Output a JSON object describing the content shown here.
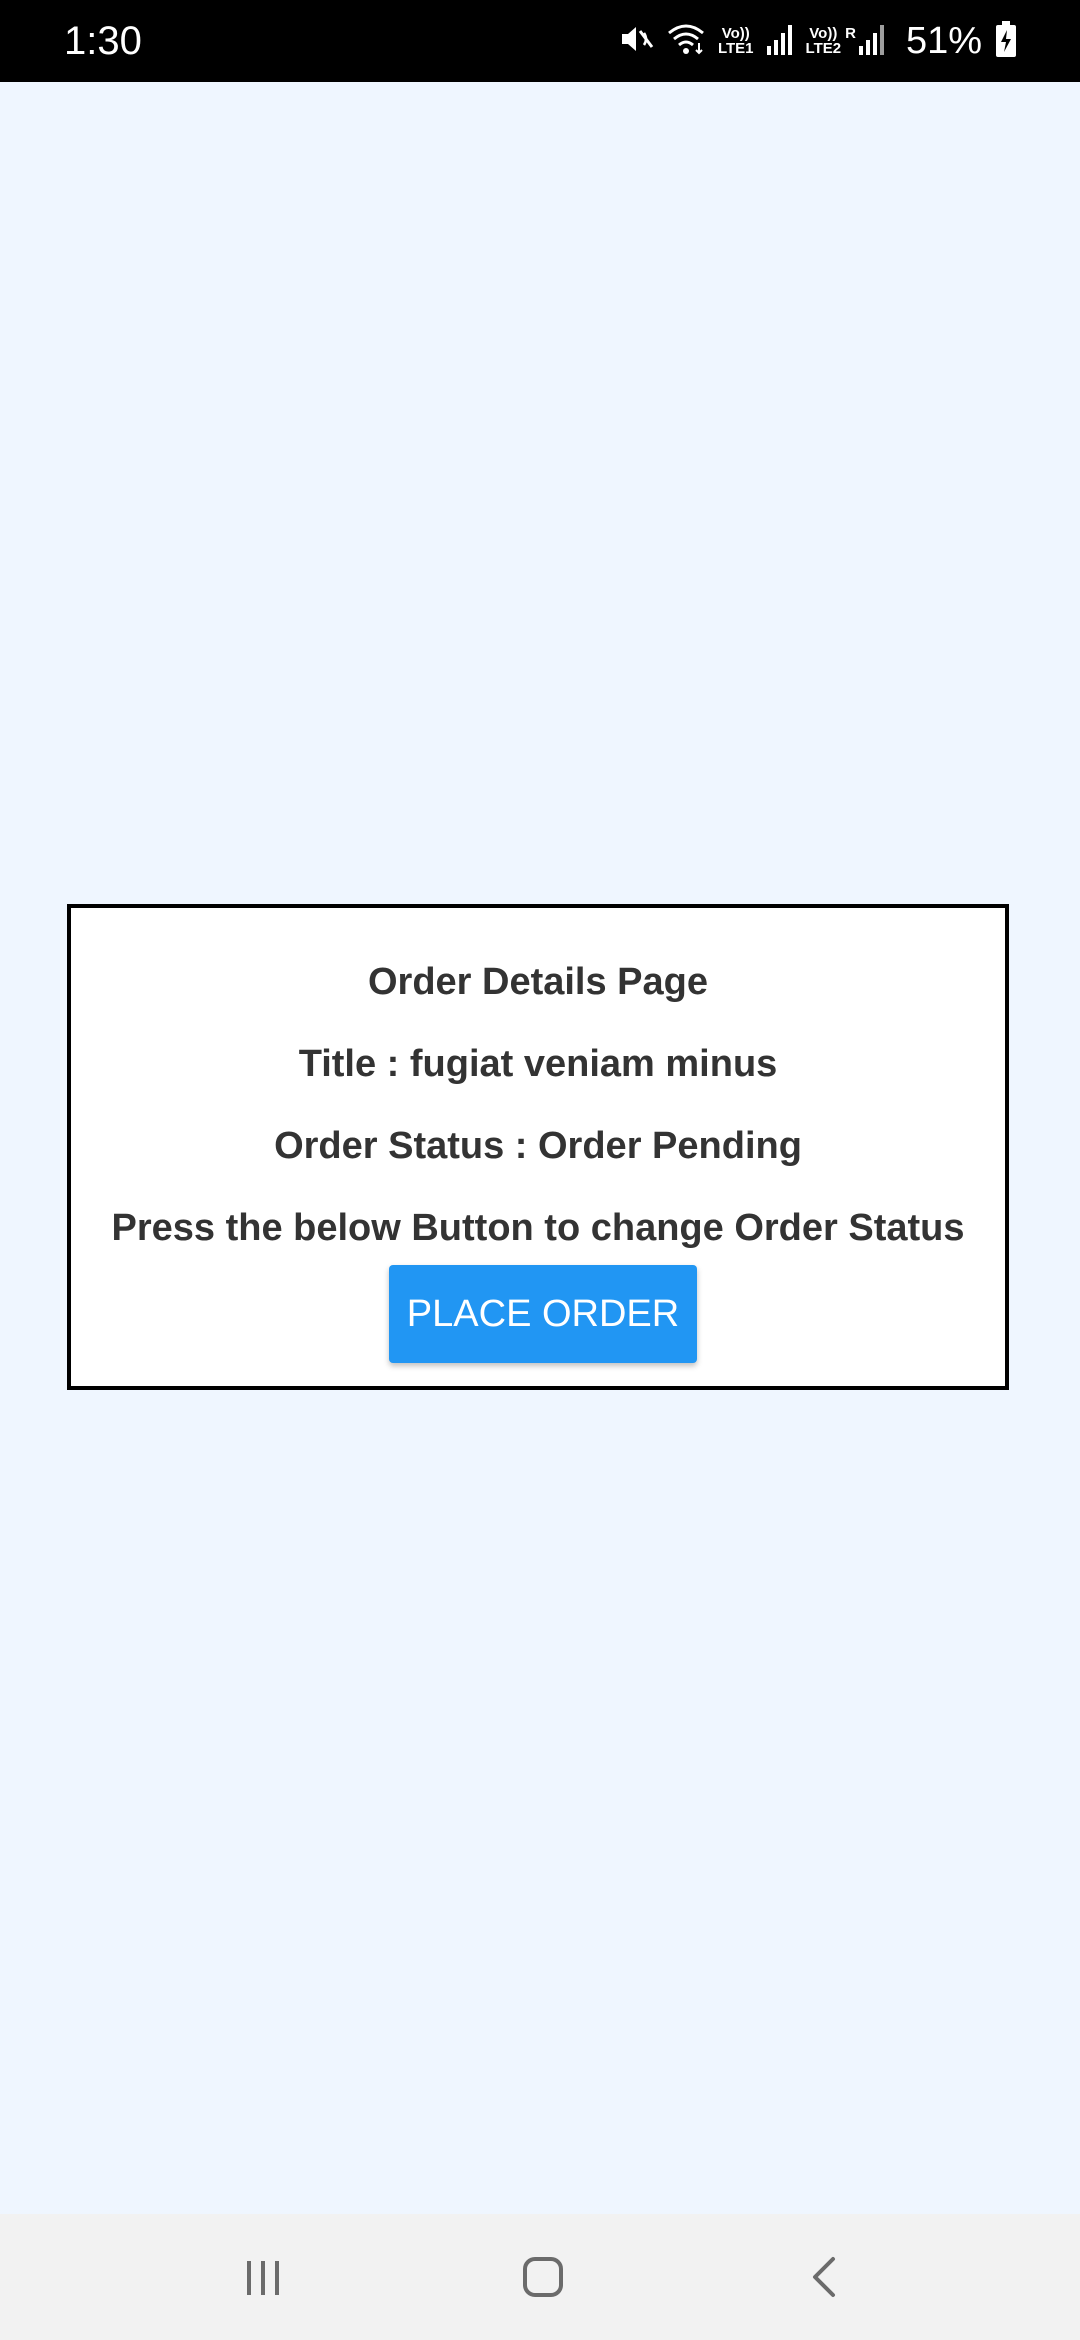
{
  "status_bar": {
    "time": "1:30",
    "network_1": [
      "Vo))",
      "LTE1"
    ],
    "network_2": [
      "Vo))",
      "LTE2"
    ],
    "roaming": "R",
    "battery": "51%",
    "icons": [
      "mute-icon",
      "wifi-icon",
      "signal-icon",
      "signal-icon",
      "battery-charging-icon"
    ]
  },
  "card": {
    "heading": "Order Details Page",
    "title_line": "Title : fugiat veniam minus",
    "status_line": "Order Status : Order Pending",
    "instruction": "Press the below Button to change Order Status",
    "button_label": "PLACE ORDER"
  },
  "nav_bar": {
    "icons": [
      "recent-apps-icon",
      "home-icon",
      "back-icon"
    ]
  },
  "colors": {
    "background": "#eff6ff",
    "card_border": "#000000",
    "text": "#333333",
    "button": "#2196f3",
    "status_bar": "#000000",
    "nav_bar": "#f2f2f2"
  }
}
